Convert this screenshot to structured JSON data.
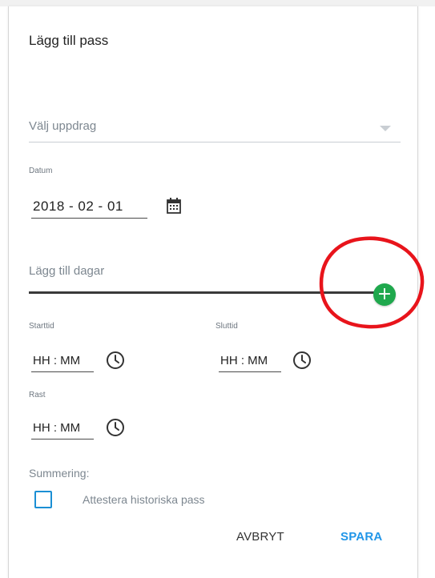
{
  "dialog": {
    "title": "Lägg till pass",
    "assignment_select": {
      "placeholder": "Välj uppdrag"
    },
    "date": {
      "label": "Datum",
      "value": "2018 - 02 - 01"
    },
    "add_days": {
      "label": "Lägg till dagar",
      "button_symbol": "+"
    },
    "start_time": {
      "label": "Starttid",
      "value": "HH : MM"
    },
    "end_time": {
      "label": "Sluttid",
      "value": "HH : MM"
    },
    "break_time": {
      "label": "Rast",
      "value": "HH : MM"
    },
    "summary": {
      "label": "Summering:"
    },
    "attest_checkbox": {
      "label": "Attestera historiska pass",
      "checked": false
    },
    "actions": {
      "cancel": "AVBRYT",
      "save": "SPARA"
    }
  },
  "icons": {
    "calendar": "calendar-icon",
    "clock": "clock-icon",
    "add": "plus-icon",
    "dropdown": "chevron-down-icon"
  },
  "colors": {
    "add_button": "#1fa84d",
    "checkbox_border": "#1b8fd4",
    "save_text": "#2196e8",
    "annotation_circle": "#e8141b",
    "muted_text": "#7d8790"
  }
}
